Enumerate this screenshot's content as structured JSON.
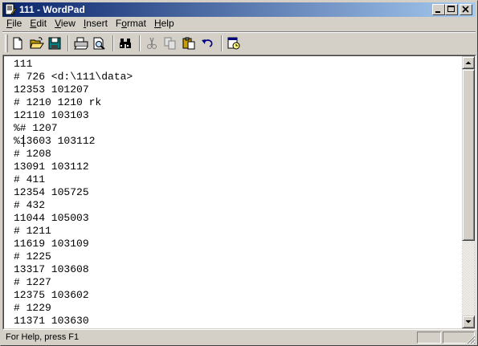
{
  "window": {
    "title": "111 - WordPad",
    "title_colors": {
      "active_start": "#0a246a",
      "active_end": "#a6caf0"
    },
    "caption_buttons": [
      "minimize-icon",
      "maximize-icon",
      "close-icon"
    ]
  },
  "menu": {
    "items": [
      {
        "mnemonic": "F",
        "rest": "ile"
      },
      {
        "mnemonic": "E",
        "rest": "dit"
      },
      {
        "mnemonic": "V",
        "rest": "iew"
      },
      {
        "mnemonic": "I",
        "rest": "nsert"
      },
      {
        "pre": "F",
        "mnemonic": "o",
        "rest": "rmat"
      },
      {
        "mnemonic": "H",
        "rest": "elp"
      }
    ]
  },
  "toolbar": {
    "buttons": [
      {
        "icon": "new-document-icon",
        "enabled": true
      },
      {
        "icon": "open-folder-icon",
        "enabled": true
      },
      {
        "icon": "save-disk-icon",
        "enabled": true
      },
      {
        "icon": "print-icon",
        "enabled": true
      },
      {
        "icon": "print-preview-icon",
        "enabled": true
      },
      {
        "icon": "find-binoculars-icon",
        "enabled": true
      },
      {
        "icon": "cut-scissors-icon",
        "enabled": false
      },
      {
        "icon": "copy-icon",
        "enabled": false
      },
      {
        "icon": "paste-icon",
        "enabled": true
      },
      {
        "icon": "undo-icon",
        "enabled": true
      },
      {
        "icon": "date-time-icon",
        "enabled": true
      }
    ]
  },
  "document": {
    "lines": [
      "111",
      "# 726 <d:\\111\\data>",
      "12353 101207",
      "# 1210 1210 rk",
      "12110 103103",
      "%# 1207",
      "%13603 103112",
      "# 1208",
      "13091 103112",
      "# 411",
      "12354 105725",
      "# 432",
      "11044 105003",
      "# 1211",
      "11619 103109",
      "# 1225",
      "13317 103608",
      "# 1227",
      "12375 103602",
      "# 1229",
      "11371 103630"
    ]
  },
  "status": {
    "text": "For Help, press F1"
  }
}
